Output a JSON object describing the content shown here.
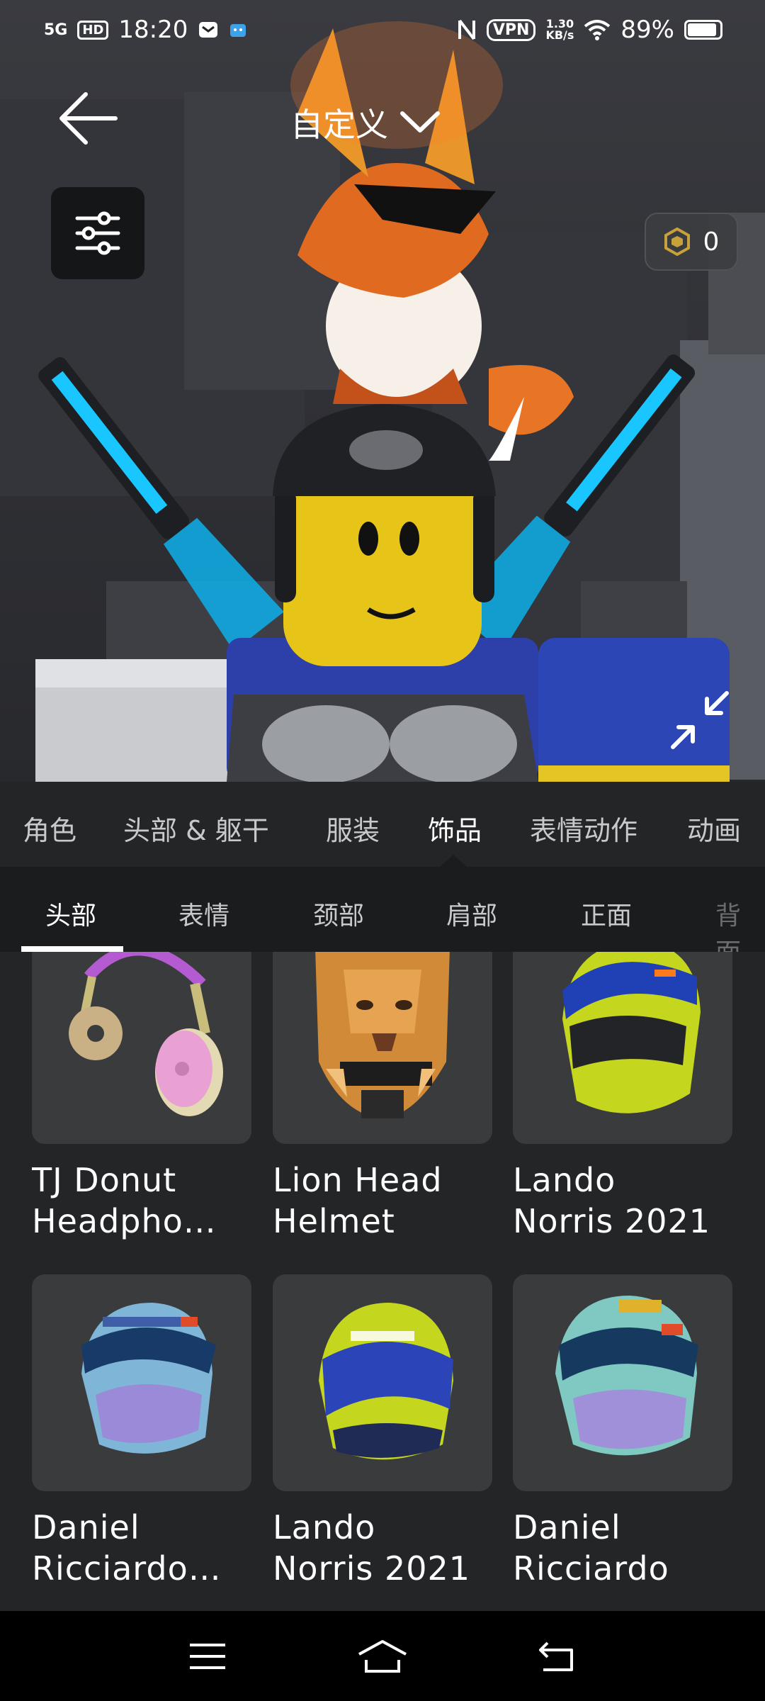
{
  "status_bar": {
    "signal": "5G",
    "hd": "HD",
    "time": "18:20",
    "vpn": "VPN",
    "speed_value": "1.30",
    "speed_unit": "KB/s",
    "battery": "89%"
  },
  "header": {
    "title": "自定义"
  },
  "robux": {
    "count": "0"
  },
  "category_tabs": [
    {
      "label": "角色",
      "active": false
    },
    {
      "label": "头部 & 躯干",
      "active": false
    },
    {
      "label": "服装",
      "active": false
    },
    {
      "label": "饰品",
      "active": true
    },
    {
      "label": "表情动作",
      "active": false
    },
    {
      "label": "动画",
      "active": false
    }
  ],
  "sub_tabs": [
    {
      "label": "头部",
      "active": true
    },
    {
      "label": "表情",
      "active": false
    },
    {
      "label": "颈部",
      "active": false
    },
    {
      "label": "肩部",
      "active": false
    },
    {
      "label": "正面",
      "active": false
    },
    {
      "label": "背面",
      "active": false
    }
  ],
  "items": [
    {
      "name_line1": "TJ Donut",
      "name_line2": "Headpho…",
      "icon": "donut-headphones-icon"
    },
    {
      "name_line1": "Lion Head",
      "name_line2": "Helmet",
      "icon": "lion-helmet-icon"
    },
    {
      "name_line1": "Lando",
      "name_line2": "Norris 2021",
      "icon": "racing-helmet-icon"
    },
    {
      "name_line1": "Daniel",
      "name_line2": "Ricciardo…",
      "icon": "racing-helmet-icon"
    },
    {
      "name_line1": "Lando",
      "name_line2": "Norris 2021",
      "icon": "racing-helmet-icon"
    },
    {
      "name_line1": "Daniel",
      "name_line2": "Ricciardo",
      "icon": "racing-helmet-icon"
    }
  ],
  "colors": {
    "background": "#232527",
    "card": "#393b3d",
    "subtab_bg": "#1b1c1d"
  }
}
